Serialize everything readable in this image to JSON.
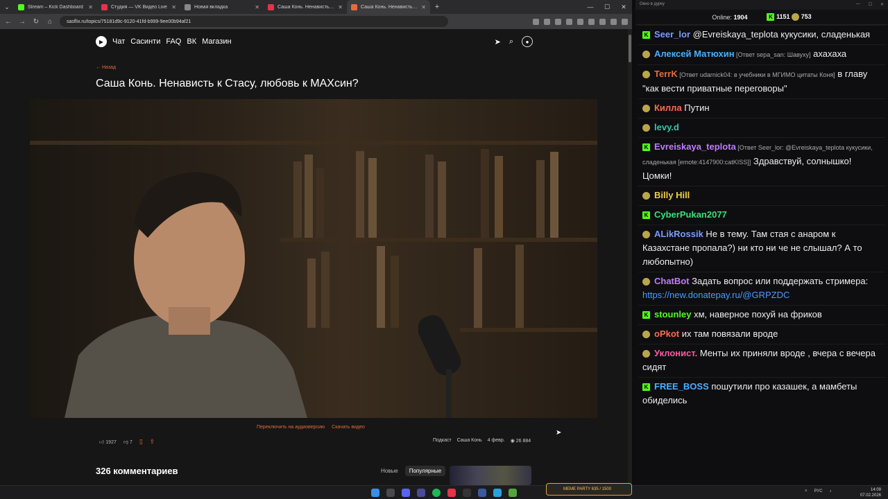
{
  "browser": {
    "tabs": [
      {
        "title": "Stream – Kick Dashboard",
        "color": "#53fc18",
        "active": false
      },
      {
        "title": "Студия — VK Видео Live",
        "color": "#e3344a",
        "active": false
      },
      {
        "title": "Новая вкладка",
        "color": "#888888",
        "active": false
      },
      {
        "title": "Саша Конь. Ненависть к Стасу",
        "color": "#e3344a",
        "active": false
      },
      {
        "title": "Саша Конь. Ненависть к С",
        "color": "#e86a3c",
        "active": true
      }
    ],
    "url": "sasflix.ru/topics/75181d9c-9120-41fd-b999-9ee00b94af21"
  },
  "site": {
    "nav": [
      "Чат",
      "Сасинти",
      "FAQ",
      "ВК",
      "Магазин"
    ],
    "back": "← Назад",
    "title": "Саша Конь. Ненависть к Стасу, любовь к МАХсин?",
    "audio_link": "Переключить на аудиоверсию",
    "download_link": "Скачать видео",
    "likes": "1927",
    "dislikes": "7",
    "tags": [
      "Подкаст",
      "Саша Конь"
    ],
    "date": "4 февр.",
    "views": "26 884",
    "comments_title": "326 комментариев",
    "sort": [
      "Новые",
      "Популярные"
    ]
  },
  "chat": {
    "window_title": "Окно в дурку",
    "online_label": "Online:",
    "online": "1904",
    "kick_count": "1151",
    "other_count": "753",
    "messages": [
      {
        "name": "Seer_lor",
        "color": "#7b9bff",
        "badge": "kick",
        "text": "@Evreiskaya_teplota кукусики, сладенькая",
        "mention_color": "#e8c14a",
        "reply": ""
      },
      {
        "name": "Алексей Матюхин",
        "color": "#4ab0ff",
        "badge": "emoji",
        "text": "ахахаха",
        "reply": "[Ответ sepa_san: Шавуху]"
      },
      {
        "name": "TerrK",
        "color": "#e86a3c",
        "badge": "emoji",
        "text": "в главу \"как вести приватные переговоры\"",
        "reply": "[Ответ udarnick04: в учебники в МГИМО цитаты Коня]"
      },
      {
        "name": "Килла",
        "color": "#ff6a50",
        "badge": "emoji",
        "text": "Путин",
        "reply": ""
      },
      {
        "name": "levy.d",
        "color": "#3ac3b0",
        "badge": "emoji",
        "text": "",
        "reply": ""
      },
      {
        "name": "Evreiskaya_teplota",
        "color": "#c07bff",
        "badge": "kick",
        "text": "Здравствуй, солнышко! Цомки!",
        "reply": "[Ответ Seer_lor: @Evreiskaya_teplota кукусики, сладенькая [emote:4147900:catKISS]]"
      },
      {
        "name": "Billy Hill",
        "color": "#f0d040",
        "badge": "emoji",
        "text": "",
        "reply": ""
      },
      {
        "name": "CyberPukan2077",
        "color": "#3ae07a",
        "badge": "kick",
        "text": "",
        "reply": ""
      },
      {
        "name": "ALikRossik",
        "color": "#7b9bff",
        "badge": "emoji",
        "text": "Не в тему. Там стая с анаром к Казахстане пропала?) ни кто ни че не слышал? А то любопытно)",
        "reply": ""
      },
      {
        "name": "ChatBot",
        "color": "#c07bff",
        "badge": "emoji",
        "text": "Задать вопрос или поддержать стримера:",
        "link": "https://new.donatepay.ru/@GRPZDC",
        "reply": ""
      },
      {
        "name": "stounley",
        "color": "#53fc18",
        "badge": "kick",
        "text": "хм, наверное похуй на фриков",
        "reply": ""
      },
      {
        "name": "oPkot",
        "color": "#ff6a50",
        "badge": "emoji",
        "text": "их там повязали вроде",
        "reply": ""
      },
      {
        "name": "Уклонист.",
        "color": "#ff5aa0",
        "badge": "emoji",
        "text": "Менты их приняли вроде , вчера с вечера сидят",
        "reply": ""
      },
      {
        "name": "FREE_BOSS",
        "color": "#4ab0ff",
        "badge": "kick",
        "text": "пошутили про казашек, а мамбеты обиделись",
        "reply": ""
      }
    ]
  },
  "taskbar": {
    "meme": "MEME PARTY 635 / 1500",
    "lang": "РУС",
    "time": "14:09",
    "date": "07.02.2026"
  }
}
